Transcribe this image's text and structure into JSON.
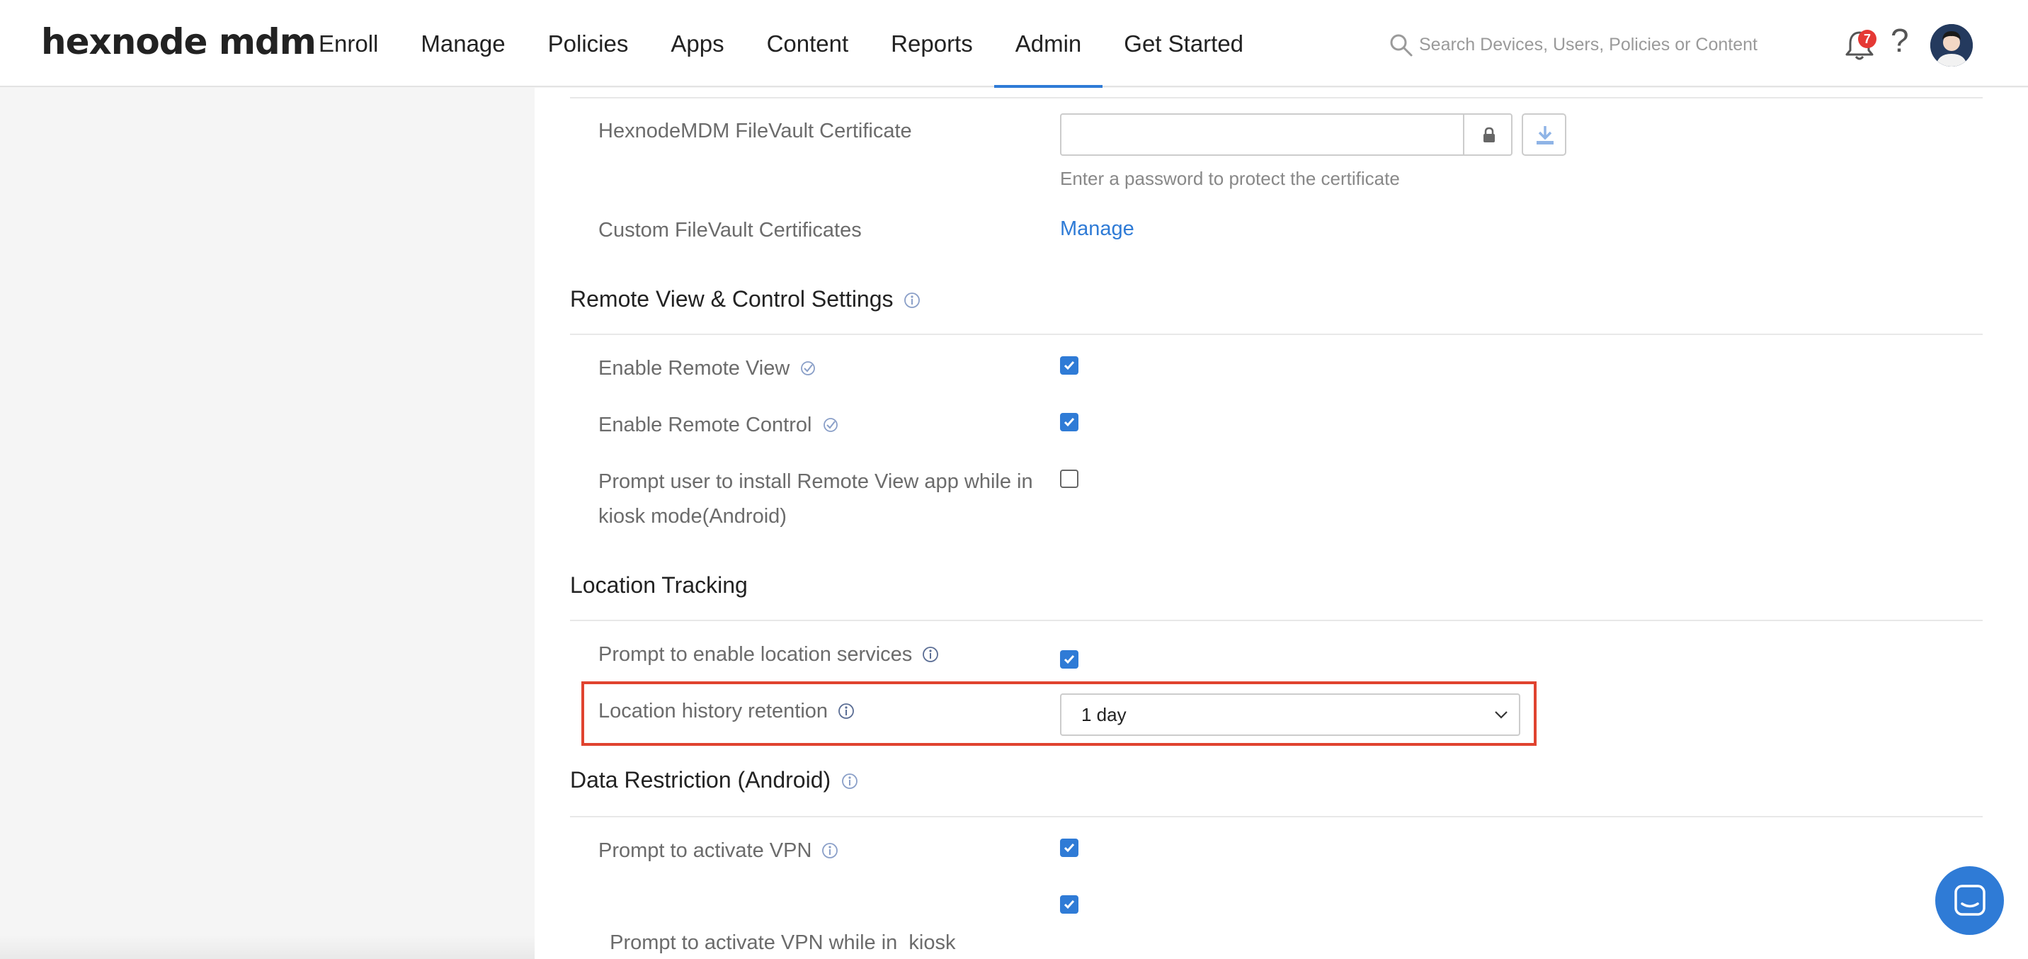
{
  "brand": {
    "logo": "hexnode mdm",
    "accent": "#2f7bd6",
    "highlight": "#e0432f"
  },
  "nav": {
    "items": [
      "Enroll",
      "Manage",
      "Policies",
      "Apps",
      "Content",
      "Reports",
      "Admin",
      "Get Started"
    ],
    "active": "Admin"
  },
  "search": {
    "placeholder": "Search Devices, Users, Policies or Content"
  },
  "notifications": {
    "count": "7"
  },
  "help": {
    "label": "?"
  },
  "filevault": {
    "certificate_label": "HexnodeMDM FileVault Certificate",
    "password_value": "",
    "password_help": "Enter a password to protect the certificate",
    "custom_label": "Custom FileVault Certificates",
    "manage_link": "Manage"
  },
  "remote_view": {
    "title": "Remote View & Control Settings",
    "rows": [
      {
        "label": "Enable Remote View",
        "checked": true
      },
      {
        "label": "Enable Remote Control",
        "checked": true
      },
      {
        "label": "Prompt user to install Remote View app while in kiosk mode(Android)",
        "line1": "Prompt user to install Remote View app while in",
        "line2": "kiosk mode(Android)",
        "checked": false
      }
    ]
  },
  "location": {
    "title": "Location Tracking",
    "prompt_label": "Prompt to enable location services",
    "prompt_checked": true,
    "retention_label": "Location history retention",
    "retention_value": "1 day"
  },
  "data_restriction": {
    "title": "Data Restriction (Android)",
    "rows": [
      {
        "label": "Prompt to activate VPN",
        "checked": true
      },
      {
        "label": "Prompt to activate VPN while in  kiosk",
        "checked": true
      }
    ]
  }
}
